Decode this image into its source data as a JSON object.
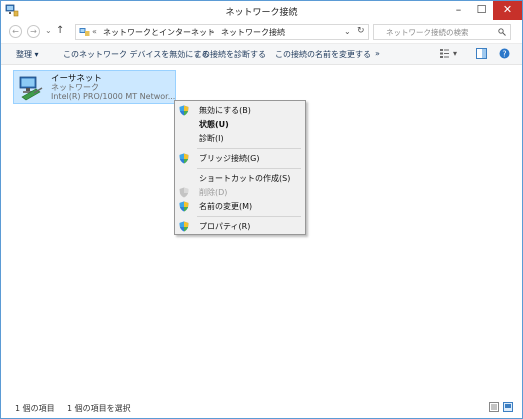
{
  "window": {
    "title": "ネットワーク接続",
    "minimize": "–",
    "maximize": "☐",
    "close": "✕"
  },
  "navigation": {
    "back": "←",
    "forward": "→",
    "history": "⌄",
    "up": "↑",
    "overflow": "«",
    "breadcrumbs": [
      "ネットワークとインターネット",
      "ネットワーク接続"
    ],
    "separator": "›",
    "dropdown": "⌄",
    "refresh": "↻",
    "search_placeholder": "ネットワーク接続の検索"
  },
  "toolbar": {
    "organize": "整理 ▾",
    "items": [
      "このネットワーク デバイスを無効にする",
      "この接続を診断する",
      "この接続の名前を変更する"
    ],
    "more": "»"
  },
  "connection": {
    "name": "イーサネット",
    "type": "ネットワーク",
    "device": "Intel(R) PRO/1000 MT Networ..."
  },
  "context_menu": {
    "items": [
      {
        "label": "無効にする(B)",
        "icon": "shield-icon",
        "bold": false,
        "disabled": false
      },
      {
        "label": "状態(U)",
        "icon": "",
        "bold": true,
        "disabled": false
      },
      {
        "label": "診断(I)",
        "icon": "",
        "bold": false,
        "disabled": false
      },
      {
        "label": "ブリッジ接続(G)",
        "icon": "shield-icon",
        "bold": false,
        "disabled": false
      },
      {
        "label": "ショートカットの作成(S)",
        "icon": "",
        "bold": false,
        "disabled": false
      },
      {
        "label": "削除(D)",
        "icon": "shield-icon",
        "bold": false,
        "disabled": true
      },
      {
        "label": "名前の変更(M)",
        "icon": "shield-icon",
        "bold": false,
        "disabled": false
      },
      {
        "label": "プロパティ(R)",
        "icon": "shield-icon",
        "bold": false,
        "disabled": false
      }
    ]
  },
  "statusbar": {
    "count": "1 個の項目",
    "selected": "1 個の項目を選択"
  },
  "colors": {
    "accent": "#5b9bd5",
    "selection": "#cce8ff",
    "close": "#c7312a"
  }
}
